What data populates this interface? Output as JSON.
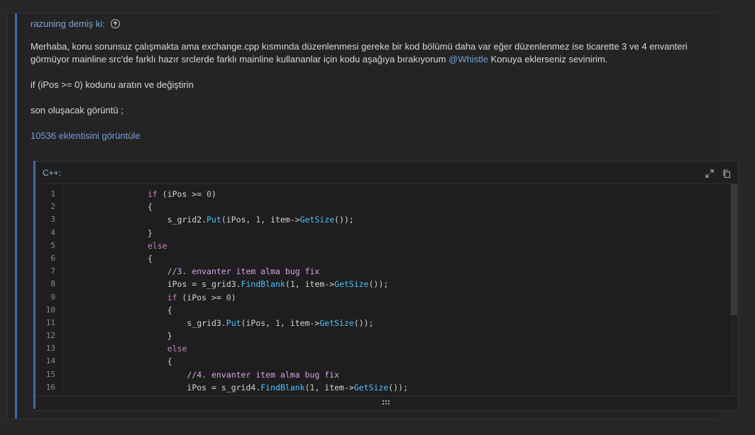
{
  "quote": {
    "author_line": "razuning demiş ki:",
    "paragraph1_part1": "Merhaba, konu sorunsuz çalışmakta ama exchange.cpp kısmında düzenlenmesi gereke bir kod bölümü daha var eğer düzenlenmez ise ticarette 3 ve 4 envanteri görmüyor mainline src'de farklı hazır srclerde farklı mainline kullananlar için kodu aşağıya bırakıyorum ",
    "mention": "@Whistle",
    "paragraph1_part2": " Konuya eklerseniz sevinirim.",
    "paragraph2": "if (iPos >= 0) kodunu aratın ve değiştirin",
    "paragraph3": "son oluşacak görüntü ;",
    "attachment_link": "10536 eklentisini görüntüle"
  },
  "code": {
    "language_label": "C++:",
    "lines": [
      {
        "n": "1"
      },
      {
        "n": "2"
      },
      {
        "n": "3"
      },
      {
        "n": "4"
      },
      {
        "n": "5"
      },
      {
        "n": "6"
      },
      {
        "n": "7"
      },
      {
        "n": "8"
      },
      {
        "n": "9"
      },
      {
        "n": "10"
      },
      {
        "n": "11"
      },
      {
        "n": "12"
      },
      {
        "n": "13"
      },
      {
        "n": "14"
      },
      {
        "n": "15"
      },
      {
        "n": "16"
      }
    ],
    "t": {
      "if": "if",
      "else": "else",
      "ipos_cond": " (iPos >= ",
      "zero": "0",
      "close_paren": ")",
      "open_brace": "{",
      "close_brace": "}",
      "grid2": "s_grid2.",
      "grid3_put": "s_grid3.",
      "put": "Put",
      "put_args_a": "(iPos, ",
      "one": "1",
      "put_args_b": ", item->",
      "getsize": "GetSize",
      "end_call": "());",
      "comment3": "//3. envanter item alma bug fix",
      "comment4": "//4. envanter item alma bug fix",
      "ipos_assign3": "iPos = s_grid3.",
      "ipos_assign4": "iPos = s_grid4.",
      "findblank": "FindBlank",
      "fb_open": "(",
      "fb_mid": ", item->"
    }
  },
  "icons": {
    "expand": "expand-icon",
    "copy": "copy-icon",
    "grip": "grip-icon",
    "scroll_up": "arrow-up-circle-icon"
  },
  "colors": {
    "keyword": "#c586c0",
    "function": "#4fc1ff",
    "number": "#b5cea8",
    "comment": "#d8a2e8",
    "accent": "#3a6ea5"
  }
}
